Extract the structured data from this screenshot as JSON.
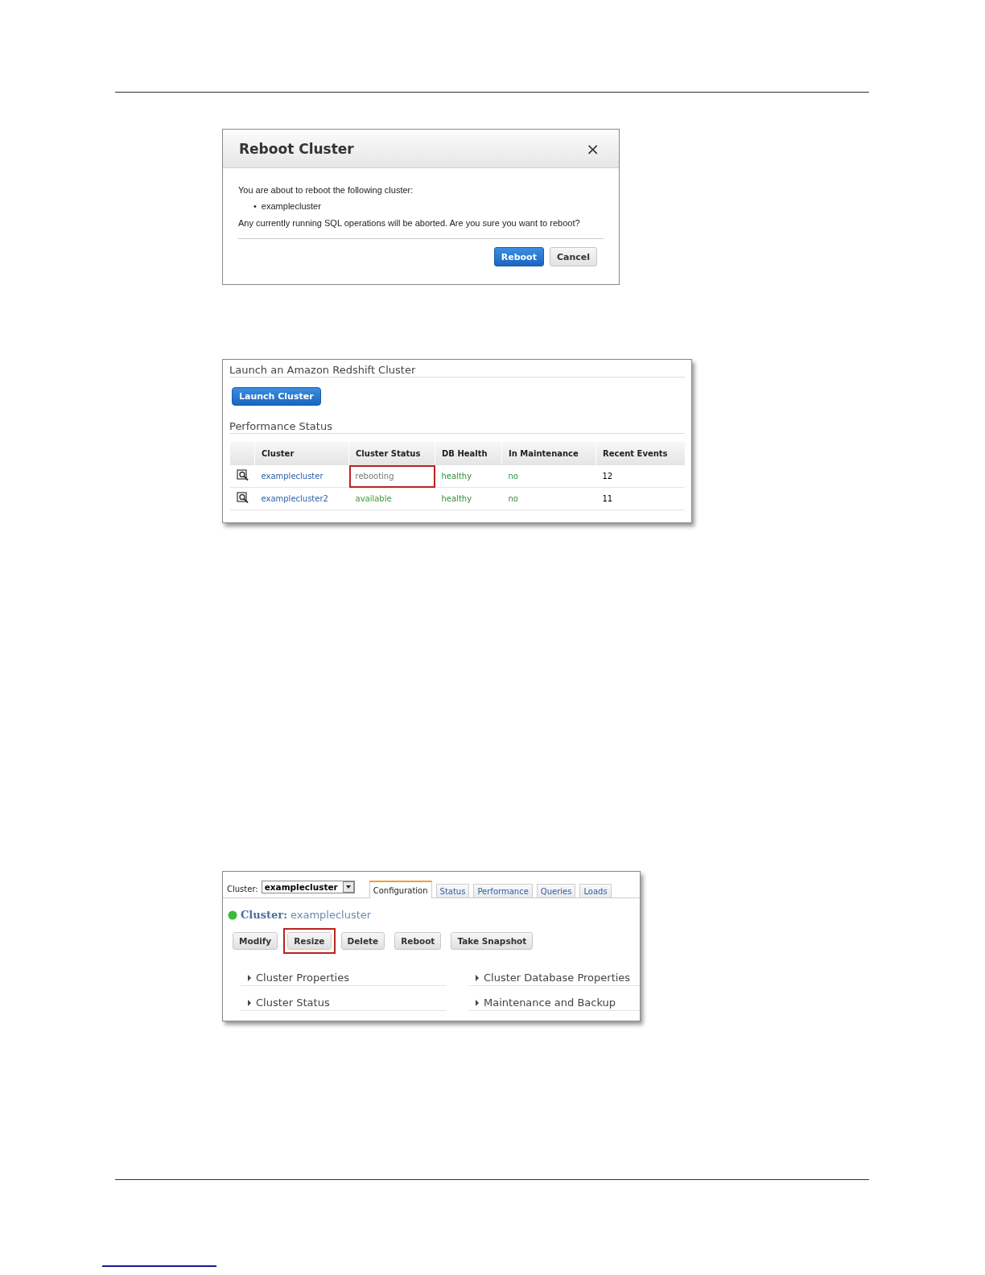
{
  "reboot_dialog": {
    "title": "Reboot Cluster",
    "close": "×",
    "message": "You are about to reboot the following cluster:",
    "clusters": [
      {
        "bullet": "•",
        "name": "examplecluster"
      }
    ],
    "warning": "Any currently running SQL operations will be aborted. Are you sure you want to reboot?",
    "buttons": [
      {
        "label": "Reboot",
        "kind": "primary"
      },
      {
        "label": "Cancel",
        "kind": "secondary"
      }
    ]
  },
  "cluster_list": {
    "heading": "Launch an Amazon Redshift Cluster",
    "launch_button": "Launch Cluster",
    "section": "Performance Status",
    "columns": [
      "Cluster",
      "Cluster Status",
      "DB Health",
      "In Maintenance",
      "Recent Events"
    ],
    "rows": [
      {
        "cluster": "examplecluster",
        "status": "rebooting",
        "kind": "pending",
        "status_highlighted": true,
        "health": "healthy",
        "maintenance": "no",
        "events": "12"
      },
      {
        "cluster": "examplecluster2",
        "status": "available",
        "kind": "ready",
        "status_highlighted": false,
        "health": "healthy",
        "maintenance": "no",
        "events": "11"
      }
    ]
  },
  "cluster_detail": {
    "selector_label": "Cluster:",
    "selector_value": "examplecluster",
    "tabs": [
      {
        "label": "Configuration",
        "selected": true
      },
      {
        "label": "Status",
        "selected": false
      },
      {
        "label": "Performance",
        "selected": false
      },
      {
        "label": "Queries",
        "selected": false
      },
      {
        "label": "Loads",
        "selected": false
      }
    ],
    "title_label": "Cluster:",
    "title_value": "examplecluster",
    "actions": [
      {
        "label": "Modify",
        "highlighted": false
      },
      {
        "label": "Resize",
        "highlighted": true
      },
      {
        "label": "Delete",
        "highlighted": false
      },
      {
        "label": "Reboot",
        "highlighted": false
      },
      {
        "label": "Take Snapshot",
        "highlighted": false
      }
    ],
    "sections": [
      {
        "label": "Cluster Properties",
        "expanded": false
      },
      {
        "label": "Cluster Database Properties",
        "expanded": false
      },
      {
        "label": "Cluster Status",
        "expanded": false
      },
      {
        "label": "Maintenance and Backup",
        "expanded": false
      }
    ]
  }
}
